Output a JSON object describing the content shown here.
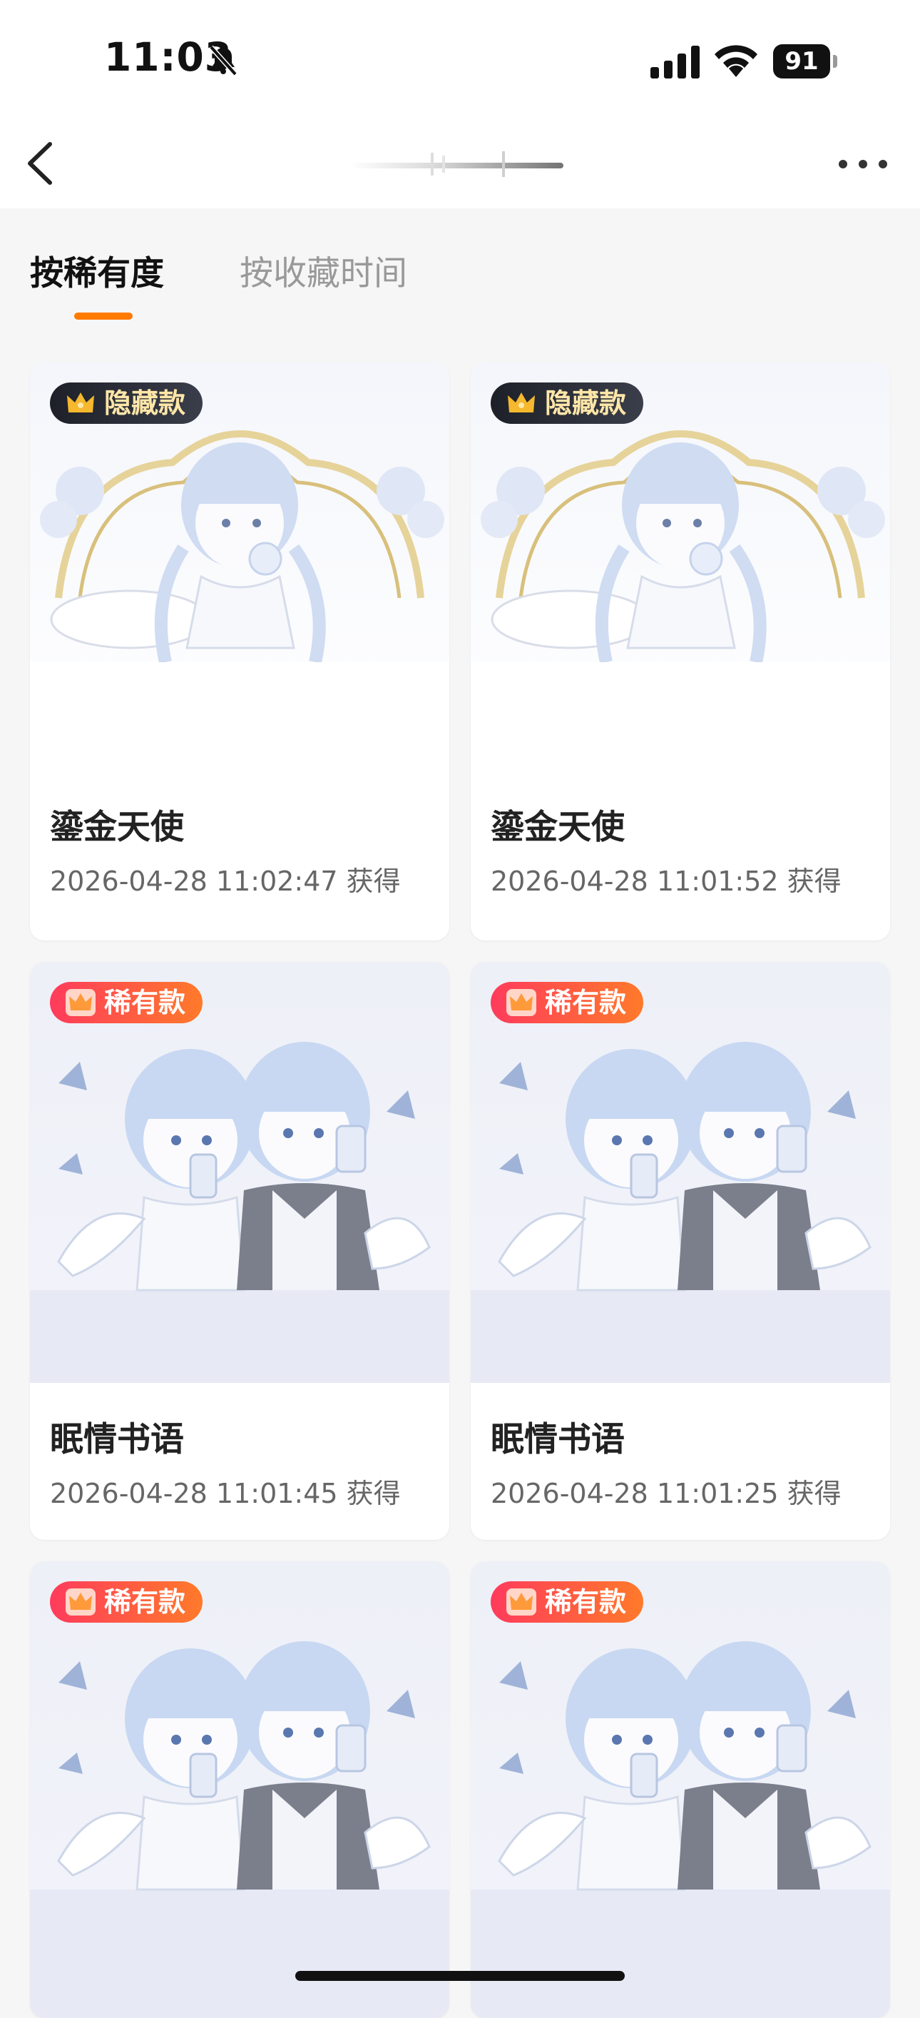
{
  "status_bar": {
    "time": "11:03",
    "battery": "91",
    "icons": [
      "bell-slash-icon",
      "cellular-signal-icon",
      "wifi-icon",
      "battery-icon"
    ]
  },
  "nav": {
    "back_icon": "chevron-left-icon",
    "more_icon": "more-horizontal-icon"
  },
  "tabs": [
    {
      "label": "按稀有度",
      "active": true
    },
    {
      "label": "按收藏时间",
      "active": false
    }
  ],
  "colors": {
    "accent": "#ff7a00",
    "hidden_badge": "#1d2028",
    "rare_badge_start": "#ff3b5c",
    "rare_badge_end": "#ff7a2a"
  },
  "items": [
    {
      "badge": "隐藏款",
      "badge_type": "hidden",
      "name": "鎏金天使",
      "time": "2026-04-28 11:02:47 获得"
    },
    {
      "badge": "隐藏款",
      "badge_type": "hidden",
      "name": "鎏金天使",
      "time": "2026-04-28 11:01:52 获得"
    },
    {
      "badge": "稀有款",
      "badge_type": "rare",
      "name": "眠情书语",
      "time": "2026-04-28 11:01:45 获得"
    },
    {
      "badge": "稀有款",
      "badge_type": "rare",
      "name": "眠情书语",
      "time": "2026-04-28 11:01:25 获得"
    },
    {
      "badge": "稀有款",
      "badge_type": "rare",
      "name": "",
      "time": ""
    },
    {
      "badge": "稀有款",
      "badge_type": "rare",
      "name": "",
      "time": ""
    }
  ]
}
